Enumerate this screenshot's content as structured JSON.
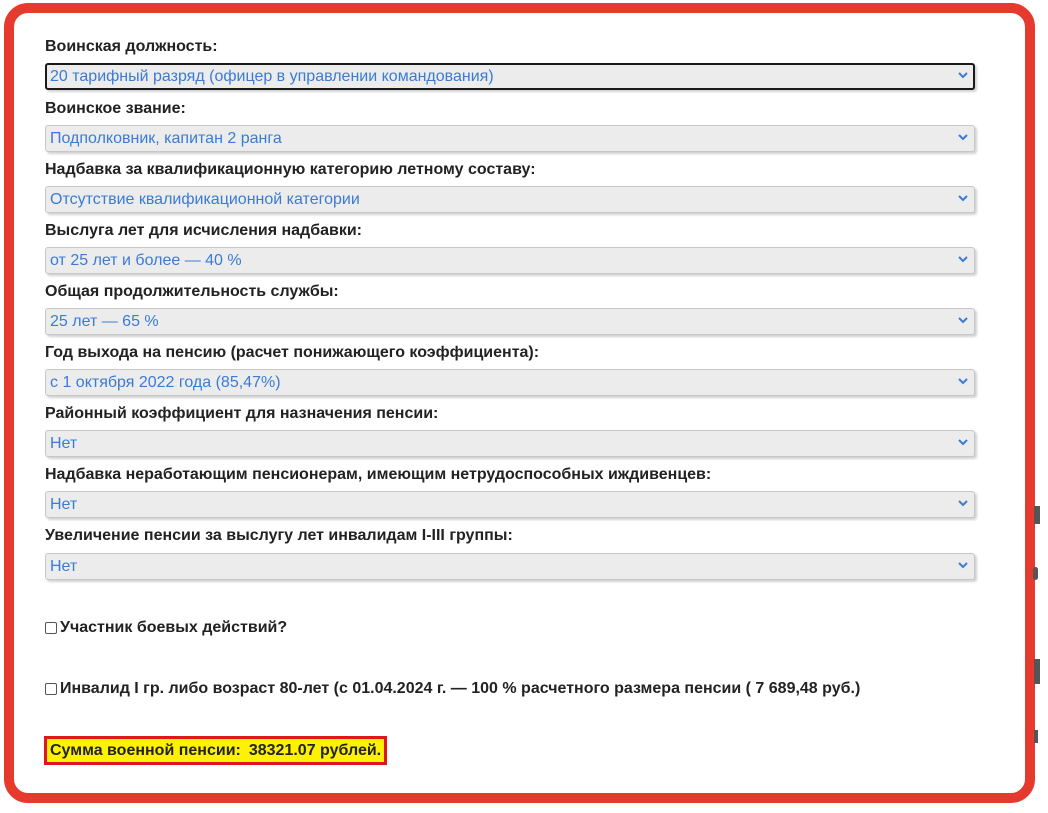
{
  "fields": [
    {
      "label": "Воинская должность:",
      "value": "20 тарифный разряд (офицер в управлении командования)",
      "focused": true
    },
    {
      "label": "Воинское звание:",
      "value": "Подполковник, капитан 2 ранга"
    },
    {
      "label": "Надбавка за квалификационную категорию летному составу:",
      "value": "Отсутствие квалификационной категории"
    },
    {
      "label": "Выслуга лет для исчисления надбавки:",
      "value": "от 25 лет и более — 40 %"
    },
    {
      "label": "Общая продолжительность службы:",
      "value": "25 лет — 65 %"
    },
    {
      "label": "Год выхода на пенсию (расчет понижающего коэффициента):",
      "value": "с 1 октября 2022 года (85,47%)"
    },
    {
      "label": "Районный коэффициент для назначения пенсии:",
      "value": "Нет"
    },
    {
      "label": "Надбавка неработающим пенсионерам, имеющим нетрудоспособных иждивенцев:",
      "value": "Нет"
    },
    {
      "label": "Увеличение пенсии за выслугу лет инвалидам I-III группы:",
      "value": "Нет"
    }
  ],
  "checkboxes": [
    {
      "label": "Участник боевых действий?",
      "checked": false
    },
    {
      "label": "Инвалид I гр. либо возраст 80-лет (с 01.04.2024 г. — 100 % расчетного размера пенсии ( 7 689,48 руб.)",
      "checked": false
    }
  ],
  "result": {
    "label": "Сумма военной пенсии:",
    "value": "38321.07 рублей."
  },
  "colors": {
    "frame": "#e63a2f",
    "select_text": "#3a7bd5",
    "result_bg": "#fff200",
    "result_border": "#e0161c"
  },
  "icons": {
    "dropdown": "chevron-down-icon"
  }
}
